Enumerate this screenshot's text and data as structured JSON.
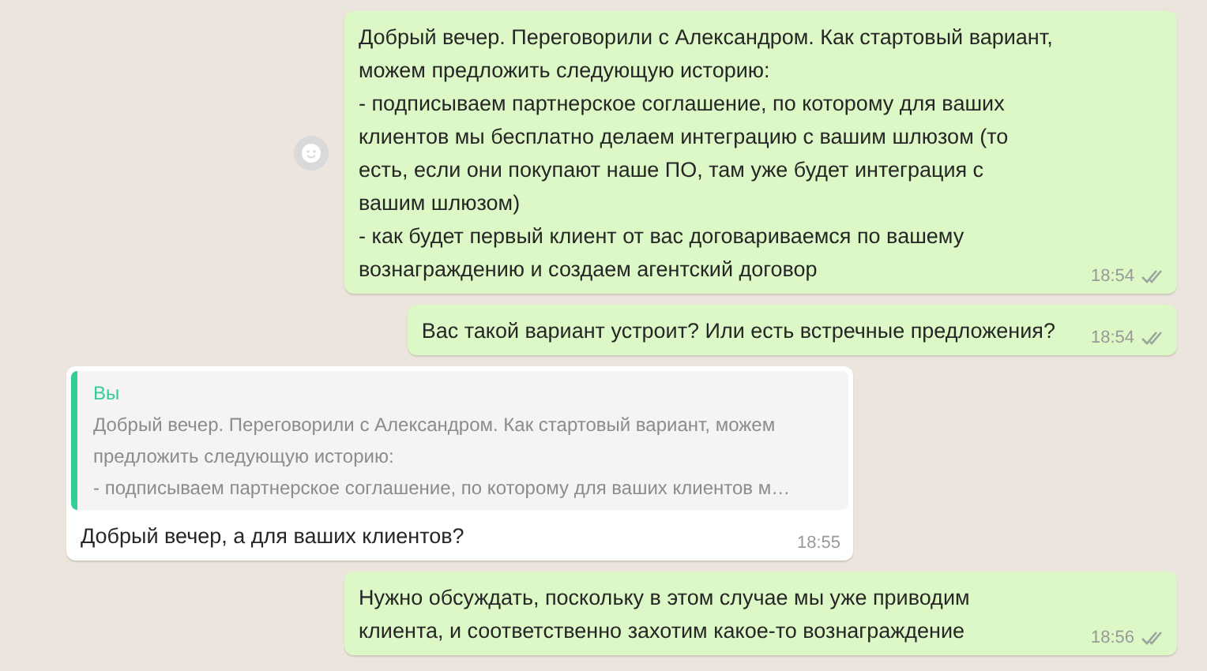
{
  "messages": [
    {
      "kind": "out",
      "reaction_button": true,
      "text": "Добрый вечер. Переговорили с Александром. Как стартовый вариант,\nможем предложить следующую историю:\n- подписываем партнерское соглашение, по которому для ваших клиентов мы бесплатно делаем интеграцию с вашим шлюзом (то есть, если они покупают наше ПО, там уже будет интеграция с вашим шлюзом)\n- как будет первый клиент от вас договариваемся по вашему вознаграждению и создаем агентский договор",
      "time": "18:54",
      "ticks": true
    },
    {
      "kind": "out",
      "reaction_button": false,
      "text": "Вас такой вариант устроит? Или есть встречные предложения?",
      "time": "18:54",
      "ticks": true
    },
    {
      "kind": "in",
      "reaction_button": false,
      "quote": {
        "author": "Вы",
        "lines": [
          "Добрый вечер. Переговорили с Александром. Как стартовый вариант, можем",
          "предложить следующую историю:",
          "- подписываем партнерское соглашение, по которому для ваших клиентов м…"
        ]
      },
      "text": "Добрый вечер, а для ваших клиентов?",
      "time": "18:55",
      "ticks": false
    },
    {
      "kind": "out",
      "reaction_button": false,
      "text": "Нужно обсуждать, поскольку в этом случае мы уже приводим клиента, и соответственно захотим какое-то вознаграждение",
      "time": "18:56",
      "ticks": true
    }
  ]
}
